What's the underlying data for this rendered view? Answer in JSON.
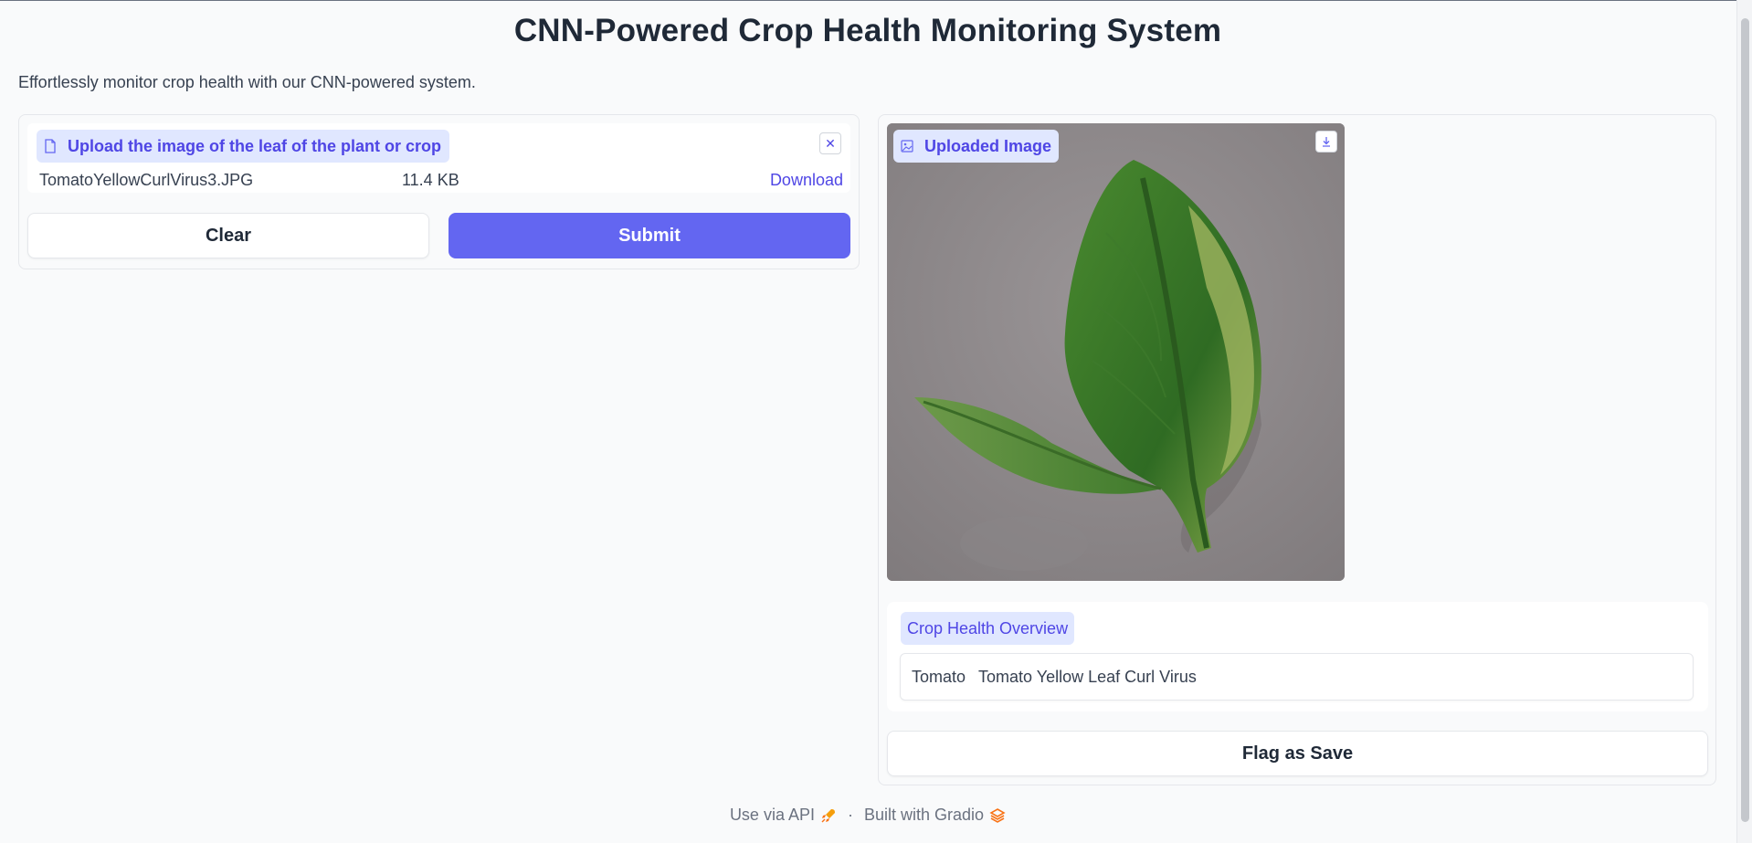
{
  "header": {
    "title": "CNN-Powered Crop Health Monitoring System",
    "description": "Effortlessly monitor crop health with our CNN-powered system."
  },
  "input": {
    "label": "Upload the image of the leaf of the plant or crop",
    "file_name": "TomatoYellowCurlVirus3.JPG",
    "file_size": "11.4 KB",
    "download_label": "Download",
    "clear_icon": "close-icon"
  },
  "buttons": {
    "clear": "Clear",
    "submit": "Submit",
    "flag": "Flag as Save"
  },
  "output": {
    "image_label": "Uploaded Image",
    "overview_label": "Crop Health Overview",
    "crop": "Tomato",
    "condition": "Tomato Yellow Leaf Curl Virus"
  },
  "footer": {
    "api": "Use via API",
    "separator": "·",
    "built": "Built with Gradio"
  },
  "colors": {
    "accent": "#6366f1",
    "badge_bg": "#e0e7ff",
    "badge_text": "#4f46e5"
  }
}
